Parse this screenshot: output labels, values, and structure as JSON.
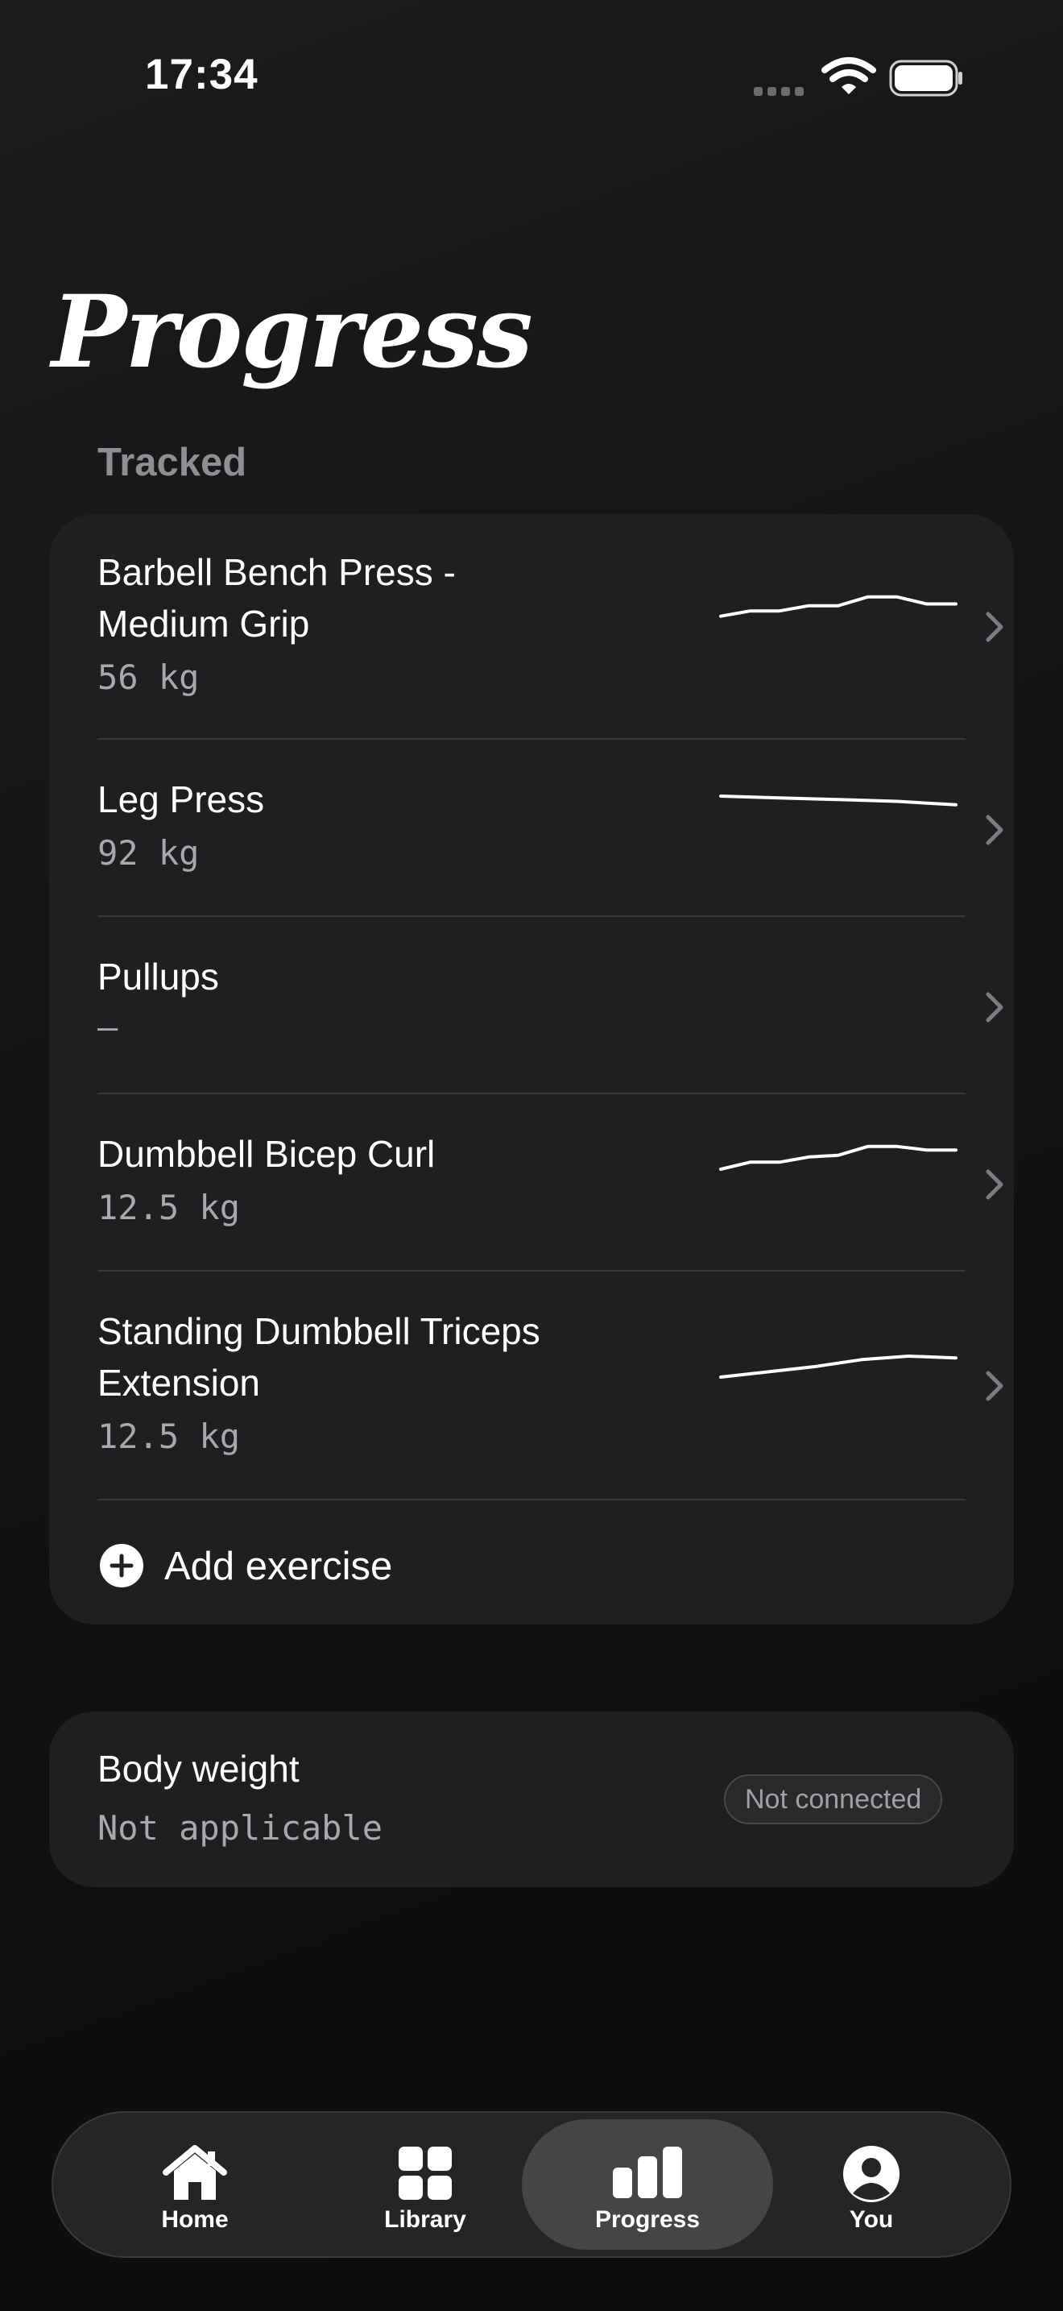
{
  "status_bar": {
    "time": "17:34"
  },
  "page": {
    "title": "Progress",
    "section_label": "Tracked"
  },
  "tracked": [
    {
      "name": "Barbell Bench Press - Medium Grip",
      "value": "56 kg",
      "has_trend": true,
      "trend": [
        8,
        11,
        11,
        14,
        14,
        19,
        19,
        15,
        15
      ]
    },
    {
      "name": "Leg Press",
      "value": "92 kg",
      "has_trend": true,
      "trend": [
        12,
        11,
        10,
        9,
        7
      ]
    },
    {
      "name": "Pullups",
      "value": "—",
      "has_trend": false,
      "trend": []
    },
    {
      "name": "Dumbbell Bicep Curl",
      "value": "12.5 kg",
      "has_trend": true,
      "trend": [
        6,
        10,
        10,
        13,
        14,
        19,
        19,
        17,
        17
      ]
    },
    {
      "name": "Standing Dumbbell Triceps Extension",
      "value": "12.5 kg",
      "has_trend": true,
      "trend": [
        6,
        9,
        12,
        16,
        18,
        17
      ]
    }
  ],
  "add_exercise": {
    "label": "Add exercise"
  },
  "body_weight": {
    "name": "Body weight",
    "value": "Not applicable",
    "status": "Not connected"
  },
  "tab_bar": {
    "tabs": [
      {
        "label": "Home",
        "icon": "house-icon",
        "active": false
      },
      {
        "label": "Library",
        "icon": "grid-icon",
        "active": false
      },
      {
        "label": "Progress",
        "icon": "bar-chart-icon",
        "active": true
      },
      {
        "label": "You",
        "icon": "person-icon",
        "active": false
      }
    ]
  }
}
